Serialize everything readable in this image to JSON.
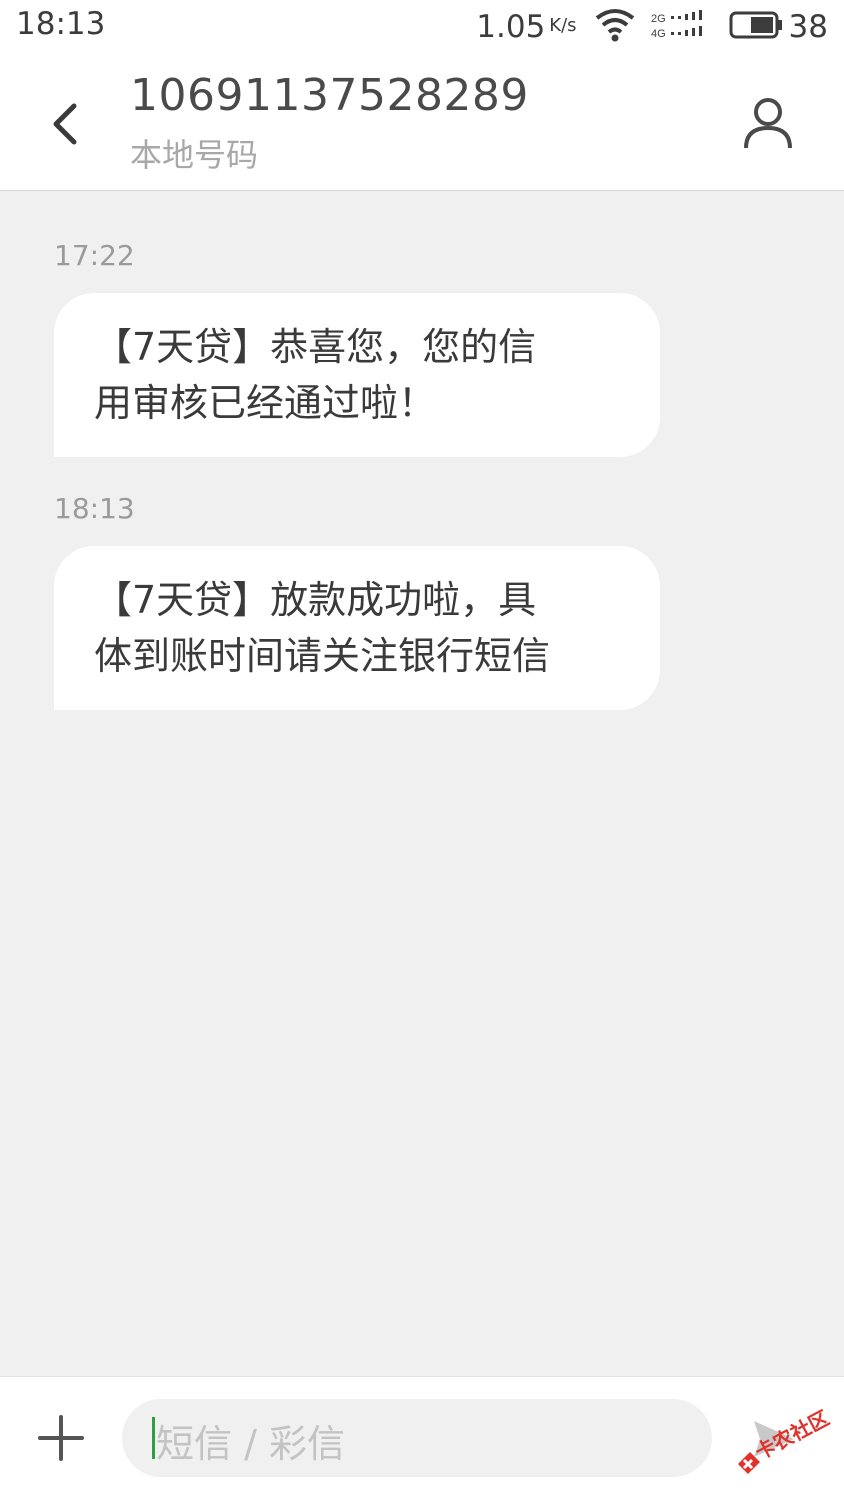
{
  "status_bar": {
    "time": "18:13",
    "network_speed": "1.05",
    "network_speed_unit": "K/s",
    "battery_level": "38",
    "icons": [
      "wifi-icon",
      "signal-icon",
      "battery-icon"
    ]
  },
  "header": {
    "contact_number": "10691137528289",
    "contact_subtitle": "本地号码",
    "back_icon": "chevron-left-icon",
    "contact_icon": "person-icon"
  },
  "messages": [
    {
      "timestamp": "17:22",
      "lines": [
        "【7天贷】恭喜您，您的信",
        "用审核已经通过啦！"
      ]
    },
    {
      "timestamp": "18:13",
      "lines": [
        "【7天贷】放款成功啦，具",
        "体到账时间请关注银行短信"
      ]
    }
  ],
  "composer": {
    "placeholder": "短信 / 彩信",
    "add_icon": "plus-icon",
    "send_icon": "send-icon"
  },
  "colors": {
    "background": "#f0f0f0",
    "bubble": "#ffffff",
    "caret": "#2ea043",
    "watermark": "#e0322b"
  },
  "watermark": {
    "text": "卡农社区"
  }
}
